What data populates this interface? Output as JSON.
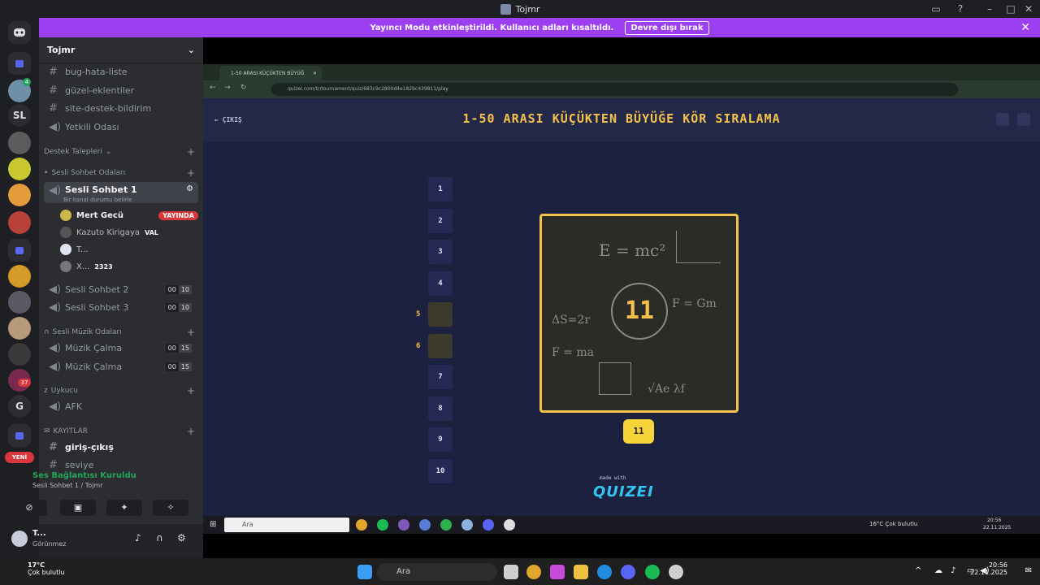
{
  "window": {
    "title": "Tojmr"
  },
  "banner": {
    "text": "Yayıncı Modu etkinleştirildi. Kullanıcı adları kısaltıldı.",
    "button": "Devre dışı bırak"
  },
  "rail": {
    "sl_label": "SL",
    "g_label": "G",
    "badge_new": "YENİ",
    "badge_4": "4",
    "badge_37": "37"
  },
  "server": {
    "name": "Tojmr"
  },
  "channels": [
    {
      "name": "bug-hata-liste"
    },
    {
      "name": "güzel-eklentiler"
    },
    {
      "name": "site-destek-bildirim"
    },
    {
      "name": "Yetkili Odası"
    }
  ],
  "categories": {
    "destek": "Destek Talepleri",
    "sesli": "Sesli Sohbet Odaları",
    "muzik": "Sesli Müzik Odaları",
    "uykucu": "Uykucu",
    "kayitlar": "KAYITLAR"
  },
  "voice_channels": {
    "active": {
      "name": "Sesli Sohbet 1",
      "status": "Bir kanal durumu belirle"
    },
    "sohbet2": {
      "name": "Sesli Sohbet 2",
      "a": "00",
      "b": "10"
    },
    "sohbet3": {
      "name": "Sesli Sohbet 3",
      "a": "00",
      "b": "10"
    },
    "muzik1": {
      "name": "Müzik Çalma",
      "a": "00",
      "b": "15"
    },
    "muzik2": {
      "name": "Müzik Çalma",
      "a": "00",
      "b": "15"
    },
    "afk": {
      "name": "AFK"
    },
    "giris": {
      "name": "giriş-çıkış"
    },
    "seviye": {
      "name": "seviye"
    }
  },
  "voice_users": [
    {
      "name": "Mert Gecü",
      "badge": "YAYINDA"
    },
    {
      "name": "Kazuto Kirigaya",
      "tag": "VAL"
    },
    {
      "name": "T..."
    },
    {
      "name": "X...",
      "tag": "2323"
    }
  ],
  "voice_panel": {
    "status": "Ses Bağlantısı Kuruldu",
    "channel": "Sesli Sohbet 1 / Tojmr"
  },
  "user": {
    "name": "T...",
    "status": "Görünmez"
  },
  "browser": {
    "tab": "1-50 ARASI KÜÇÜKTEN BÜYÜĞ",
    "url": "quizei.com/tr/tournament/quiz/683c9c2800d4e182bc439811/play"
  },
  "game": {
    "title": "1-50 ARASI KÜÇÜKTEN BÜYÜĞE KÖR SIRALAMA",
    "exit": "ÇIKIŞ",
    "slots": [
      "1",
      "2",
      "3",
      "4",
      "",
      "",
      "7",
      "8",
      "9",
      "10"
    ],
    "filled_labels": [
      "5",
      "6"
    ],
    "card_number": "11",
    "badge": "11",
    "made_with": "made with",
    "logo": "QUIZEI"
  },
  "inner_taskbar": {
    "search": "Ara",
    "weather": "16°C  Çok bulutlu",
    "time": "20:56",
    "date": "22.11.2025"
  },
  "taskbar": {
    "search": "Ara",
    "temp": "17°C",
    "weather": "Çok bulutlu",
    "time": "20:56",
    "date": "22.11.2025"
  }
}
